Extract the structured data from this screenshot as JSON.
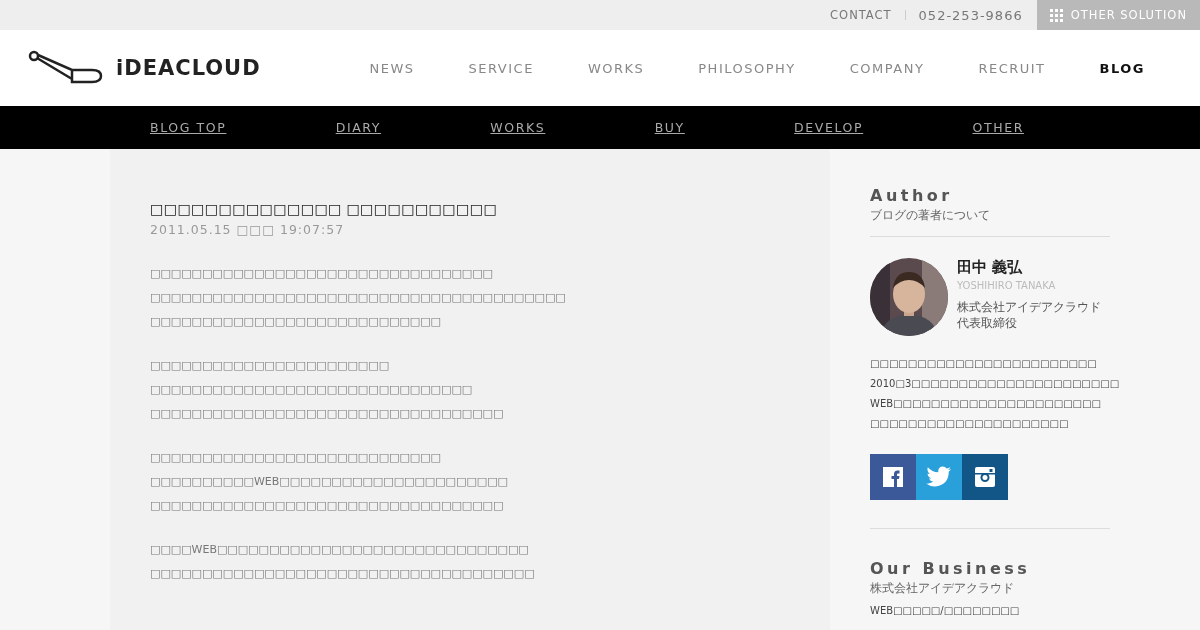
{
  "topbar": {
    "contact": "CONTACT",
    "phone": "052-253-9866",
    "solution": "OTHER SOLUTION"
  },
  "header": {
    "logo": "iDEACLOUD",
    "nav": [
      {
        "label": "NEWS",
        "selected": false
      },
      {
        "label": "SERVICE",
        "selected": false
      },
      {
        "label": "WORKS",
        "selected": false
      },
      {
        "label": "PHILOSOPHY",
        "selected": false
      },
      {
        "label": "COMPANY",
        "selected": false
      },
      {
        "label": "RECRUIT",
        "selected": false
      },
      {
        "label": "BLOG",
        "selected": true
      }
    ]
  },
  "subnav": [
    "BLOG TOP",
    "DIARY",
    "WORKS",
    "BUY",
    "DEVELOP",
    "OTHER"
  ],
  "article": {
    "title": "□□□□□□□□□□□□□□ □□□□□□□□□□□",
    "date": "2011.05.15 □□□ 19:07:57",
    "paragraphs": [
      [
        "□□□□□□□□□□□□□□□□□□□□□□□□□□□□□□□□□",
        "□□□□□□□□□□□□□□□□□□□□□□□□□□□□□□□□□□□□□□□□",
        "□□□□□□□□□□□□□□□□□□□□□□□□□□□□"
      ],
      [
        "□□□□□□□□□□□□□□□□□□□□□□□",
        "□□□□□□□□□□□□□□□□□□□□□□□□□□□□□□□",
        "□□□□□□□□□□□□□□□□□□□□□□□□□□□□□□□□□□"
      ],
      [
        "□□□□□□□□□□□□□□□□□□□□□□□□□□□□",
        "□□□□□□□□□□WEB□□□□□□□□□□□□□□□□□□□□□□",
        "□□□□□□□□□□□□□□□□□□□□□□□□□□□□□□□□□□"
      ],
      [
        "□□□□WEB□□□□□□□□□□□□□□□□□□□□□□□□□□□□□□",
        "□□□□□□□□□□□□□□□□□□□□□□□□□□□□□□□□□□□□□"
      ]
    ]
  },
  "sidebar": {
    "author_heading": "Author",
    "author_sub": "ブログの著者について",
    "name": "田中 義弘",
    "name_roman": "YOSHIHIRO TANAKA",
    "role": [
      "株式会社アイデアクラウド",
      "代表取締役"
    ],
    "bio": [
      "□□□□□□□□□□□□□□□□□□□□□□□□",
      "2010□3□□□□□□□□□□□□□□□□□□□□□□",
      "WEB□□□□□□□□□□□□□□□□□□□□□□",
      "□□□□□□□□□□□□□□□□□□□□□"
    ],
    "social": [
      {
        "kind": "facebook",
        "color": "#3b5998"
      },
      {
        "kind": "twitter",
        "color": "#2aa0db"
      },
      {
        "kind": "instagram",
        "color": "#125688"
      }
    ],
    "business_heading": "Our Business",
    "business_sub": "株式会社アイデアクラウド",
    "business_item": "WEB□□□□□/□□□□□□□□"
  }
}
